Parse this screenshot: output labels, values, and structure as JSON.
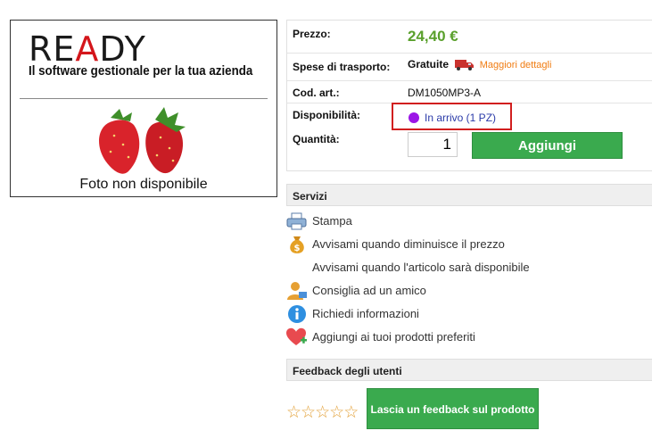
{
  "product_image": {
    "brand_logo": "READY",
    "brand_tagline": "Il software gestionale per la tua azienda",
    "placeholder_caption": "Foto non disponibile"
  },
  "info": {
    "price_label": "Prezzo:",
    "price_value": "24,40 €",
    "shipping_label": "Spese di trasporto:",
    "shipping_value": "Gratuite",
    "shipping_details_link": "Maggiori dettagli",
    "code_label": "Cod. art.:",
    "code_value": "DM1050MP3-A",
    "availability_label": "Disponibilità:",
    "availability_value": "In arrivo (1 PZ)",
    "availability_color": "#9b16e6",
    "quantity_label": "Quantità:",
    "quantity_value": "1",
    "add_button": "Aggiungi"
  },
  "services": {
    "title": "Servizi",
    "items": [
      {
        "label": "Stampa",
        "icon": "printer-icon"
      },
      {
        "label": "Avvisami quando diminuisce il prezzo",
        "icon": "money-bag-icon"
      },
      {
        "label": "Avvisami quando l'articolo sarà disponibile",
        "icon": ""
      },
      {
        "label": "Consiglia ad un amico",
        "icon": "user-share-icon"
      },
      {
        "label": "Richiedi informazioni",
        "icon": "info-icon"
      },
      {
        "label": "Aggiungi ai tuoi prodotti preferiti",
        "icon": "heart-add-icon"
      }
    ]
  },
  "feedback": {
    "title": "Feedback degli utenti",
    "rating_stars": 0,
    "max_stars": 5,
    "button": "Lascia un feedback sul prodotto"
  },
  "colors": {
    "accent_green": "#3aaa4e",
    "price_green": "#5aa02c",
    "link_orange": "#f07c12",
    "highlight_red": "#d11f1f"
  }
}
